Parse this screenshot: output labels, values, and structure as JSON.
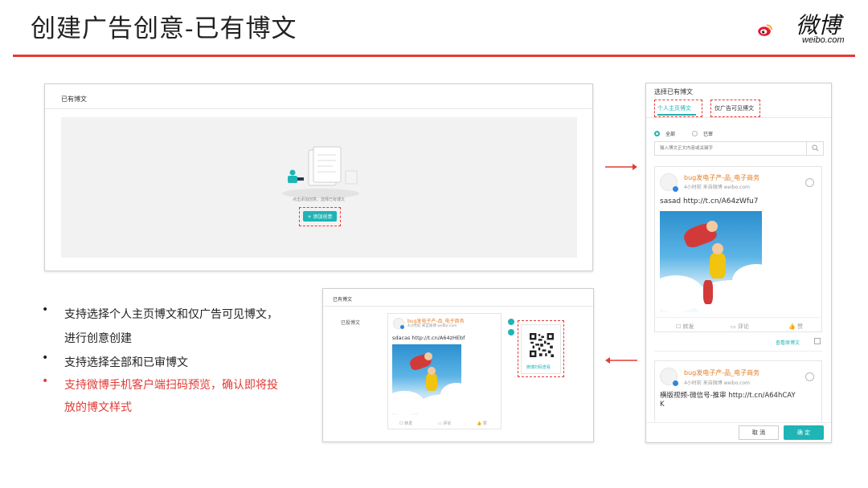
{
  "slide_title": "创建广告创意-已有博文",
  "logo": {
    "cn": "微博",
    "en": "weibo.com"
  },
  "panel1": {
    "header": "已有博文",
    "empty_hint": "点击添加创意，选择已有博文",
    "add_button": "+ 添加创意"
  },
  "bullets": [
    {
      "lines": [
        "支持选择个人主页博文和仅广告可见博文，",
        "进行创意创建"
      ],
      "color": "#222222"
    },
    {
      "lines": [
        "支持选择全部和已审博文"
      ],
      "color": "#222222"
    },
    {
      "lines": [
        "支持微博手机客户端扫码预览，确认即将投",
        "放的博文样式"
      ],
      "color": "#e23b36"
    }
  ],
  "panel2": {
    "header": "已有博文",
    "field_label": "已投博文",
    "post": {
      "user": "bug发电子产-品_电子商务",
      "meta": "4小时前 来自微博 weibo.com",
      "text": "sdacas http://t.cn/A64zHEbf",
      "actions": [
        "转发",
        "评论",
        "赞"
      ]
    },
    "qr_caption": "微博扫码查看"
  },
  "panel3": {
    "title": "选择已有博文",
    "tabs": [
      "个人主页博文",
      "仅广告可见博文"
    ],
    "filters": [
      "全部",
      "已审"
    ],
    "search_placeholder": "输入博文正文内容或关键字",
    "post1": {
      "user": "bug发电子产-品_电子商务",
      "meta": "4小时前 来自微博 weibo.com",
      "text": "sasad http://t.cn/A64zWfu7",
      "actions": [
        "转发",
        "评论",
        "赞"
      ],
      "view_link": "查看原博文"
    },
    "post2": {
      "user": "bug发电子产-品_电子商务",
      "meta": "4小时前 来自微博 weibo.com",
      "text_line1": "横版视频-微信号-推审 http://t.cn/A64hCAY",
      "text_line2": "K"
    },
    "cancel": "取 消",
    "confirm": "确 定"
  },
  "colors": {
    "accent": "#1fb4b5",
    "highlight": "#e23b36",
    "user_name": "#e67e22"
  }
}
